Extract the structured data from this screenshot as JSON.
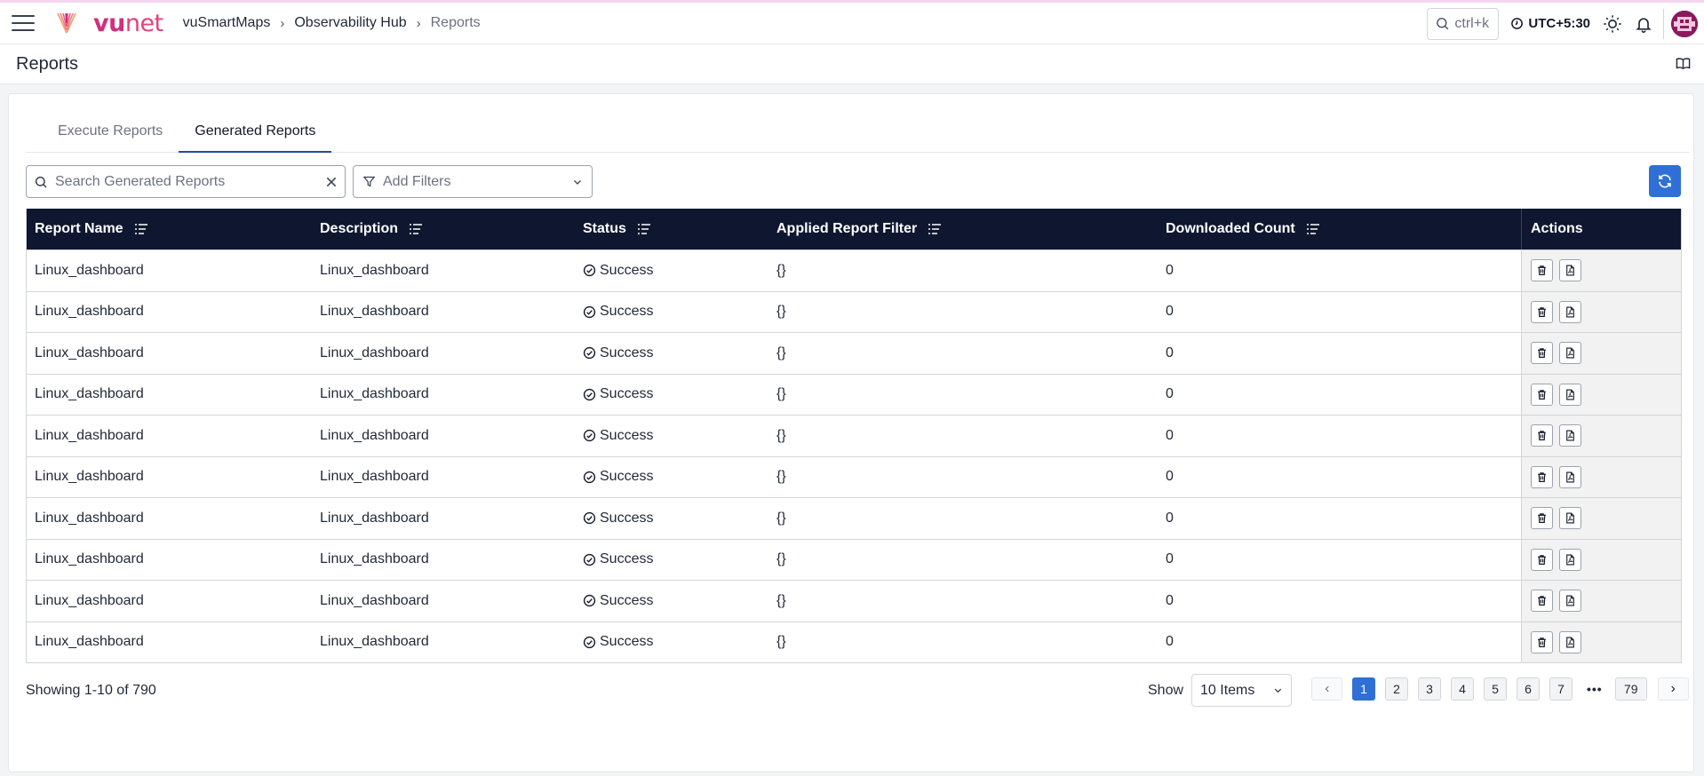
{
  "header": {
    "logo_text_bold": "vu",
    "logo_text": "net",
    "breadcrumb": [
      "vuSmartMaps",
      "Observability Hub",
      "Reports"
    ],
    "search_hint": "ctrl+k",
    "timezone": "UTC+5:30"
  },
  "page": {
    "title": "Reports"
  },
  "tabs": [
    {
      "label": "Execute Reports",
      "active": false
    },
    {
      "label": "Generated Reports",
      "active": true
    }
  ],
  "toolbar": {
    "search_placeholder": "Search Generated Reports",
    "filter_label": "Add Filters"
  },
  "table": {
    "columns": [
      "Report Name",
      "Description",
      "Status",
      "Applied Report Filter",
      "Downloaded Count",
      "Actions"
    ],
    "rows": [
      {
        "name": "Linux_dashboard",
        "description": "Linux_dashboard",
        "status": "Success",
        "filter": "{}",
        "downloads": "0"
      },
      {
        "name": "Linux_dashboard",
        "description": "Linux_dashboard",
        "status": "Success",
        "filter": "{}",
        "downloads": "0"
      },
      {
        "name": "Linux_dashboard",
        "description": "Linux_dashboard",
        "status": "Success",
        "filter": "{}",
        "downloads": "0"
      },
      {
        "name": "Linux_dashboard",
        "description": "Linux_dashboard",
        "status": "Success",
        "filter": "{}",
        "downloads": "0"
      },
      {
        "name": "Linux_dashboard",
        "description": "Linux_dashboard",
        "status": "Success",
        "filter": "{}",
        "downloads": "0"
      },
      {
        "name": "Linux_dashboard",
        "description": "Linux_dashboard",
        "status": "Success",
        "filter": "{}",
        "downloads": "0"
      },
      {
        "name": "Linux_dashboard",
        "description": "Linux_dashboard",
        "status": "Success",
        "filter": "{}",
        "downloads": "0"
      },
      {
        "name": "Linux_dashboard",
        "description": "Linux_dashboard",
        "status": "Success",
        "filter": "{}",
        "downloads": "0"
      },
      {
        "name": "Linux_dashboard",
        "description": "Linux_dashboard",
        "status": "Success",
        "filter": "{}",
        "downloads": "0"
      },
      {
        "name": "Linux_dashboard",
        "description": "Linux_dashboard",
        "status": "Success",
        "filter": "{}",
        "downloads": "0"
      }
    ]
  },
  "footer": {
    "showing": "Showing 1-10 of 790",
    "show_label": "Show",
    "page_size": "10 Items",
    "pages": [
      "1",
      "2",
      "3",
      "4",
      "5",
      "6",
      "7"
    ],
    "ellipsis": "•••",
    "last_page": "79",
    "current_page": "1"
  },
  "colors": {
    "brand": "#d0307e",
    "header_bg": "#0f1730",
    "accent": "#2f6fd6",
    "tab_underline": "#1f4e9c"
  }
}
